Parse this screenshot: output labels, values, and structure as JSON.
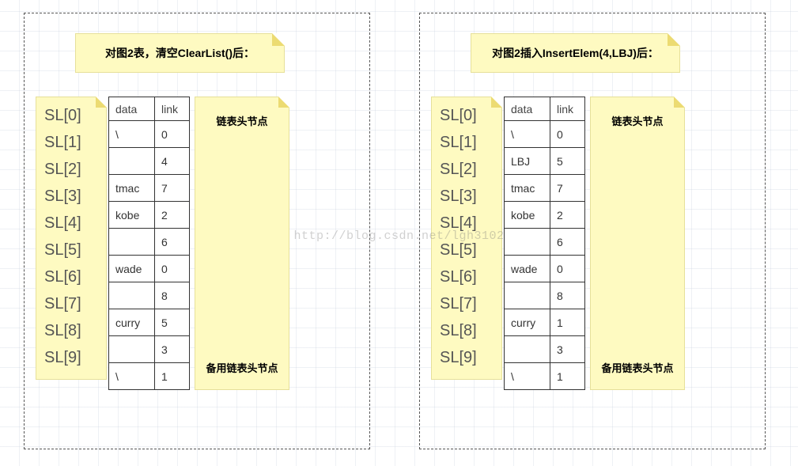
{
  "watermark": "http://blog.csdn.net/lgh3102",
  "labels": [
    "SL[0]",
    "SL[1]",
    "SL[2]",
    "SL[3]",
    "SL[4]",
    "SL[5]",
    "SL[6]",
    "SL[7]",
    "SL[8]",
    "SL[9]"
  ],
  "headers": {
    "data": "data",
    "link": "link"
  },
  "desc": {
    "head": "链表头节点",
    "spare": "备用链表头节点"
  },
  "left": {
    "title": "对图2表，清空ClearList()后：",
    "rows": [
      {
        "data": "\\",
        "link": "0"
      },
      {
        "data": "",
        "link": "4"
      },
      {
        "data": "tmac",
        "link": "7"
      },
      {
        "data": "kobe",
        "link": "2"
      },
      {
        "data": "",
        "link": "6"
      },
      {
        "data": "wade",
        "link": "0"
      },
      {
        "data": "",
        "link": "8"
      },
      {
        "data": "curry",
        "link": "5"
      },
      {
        "data": "",
        "link": "3"
      },
      {
        "data": "\\",
        "link": "1"
      }
    ]
  },
  "right": {
    "title": "对图2插入InsertElem(4,LBJ)后：",
    "rows": [
      {
        "data": "\\",
        "link": "0"
      },
      {
        "data": "LBJ",
        "link": "5"
      },
      {
        "data": "tmac",
        "link": "7"
      },
      {
        "data": "kobe",
        "link": "2"
      },
      {
        "data": "",
        "link": "6"
      },
      {
        "data": "wade",
        "link": "0"
      },
      {
        "data": "",
        "link": "8"
      },
      {
        "data": "curry",
        "link": "1"
      },
      {
        "data": "",
        "link": "3"
      },
      {
        "data": "\\",
        "link": "1"
      }
    ]
  }
}
